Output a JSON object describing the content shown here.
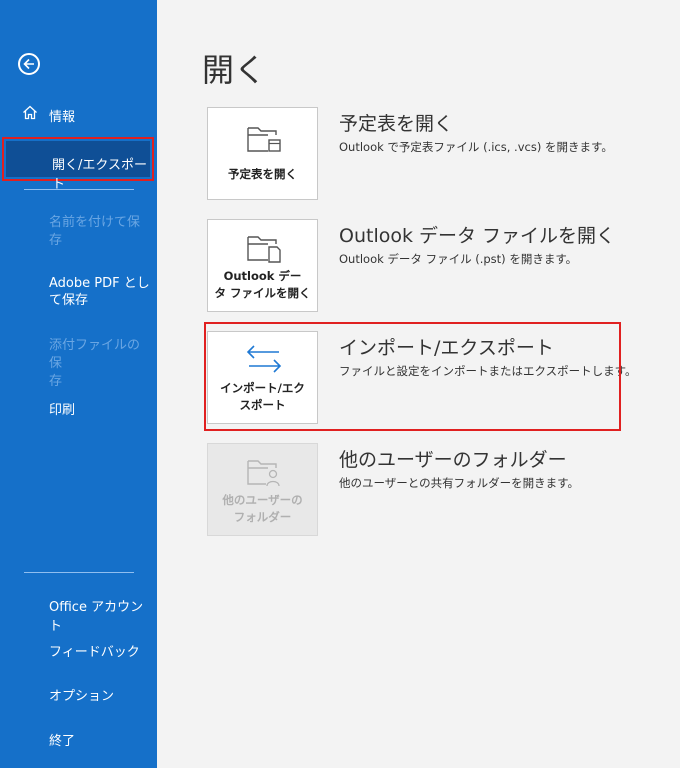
{
  "sidebar": {
    "items": [
      {
        "label": "情報"
      },
      {
        "label": "開く/エクスポート"
      },
      {
        "label": "名前を付けて保\n存"
      },
      {
        "label": "Adobe PDF とし\nて保存"
      },
      {
        "label": "添付ファイルの保\n存"
      },
      {
        "label": "印刷"
      },
      {
        "label": "Office アカウント"
      },
      {
        "label": "フィードバック"
      },
      {
        "label": "オプション"
      },
      {
        "label": "終了"
      }
    ]
  },
  "main": {
    "title": "開く",
    "options": [
      {
        "tile_label": "予定表を開く",
        "title": "予定表を開く",
        "description": "Outlook で予定表ファイル (.ics, .vcs) を開きます。"
      },
      {
        "tile_label": "Outlook デー\nタ ファイルを開く",
        "title": "Outlook データ ファイルを開く",
        "description": "Outlook データ ファイル (.pst) を開きます。"
      },
      {
        "tile_label": "インポート/エク\nスポート",
        "title": "インポート/エクスポート",
        "description": "ファイルと設定をインポートまたはエクスポートします。"
      },
      {
        "tile_label": "他のユーザーの\nフォルダー",
        "title": "他のユーザーのフォルダー",
        "description": "他のユーザーとの共有フォルダーを開きます。"
      }
    ]
  },
  "colors": {
    "sidebar": "#1570c9",
    "selected": "#0f4f96",
    "highlight": "#e02020"
  }
}
